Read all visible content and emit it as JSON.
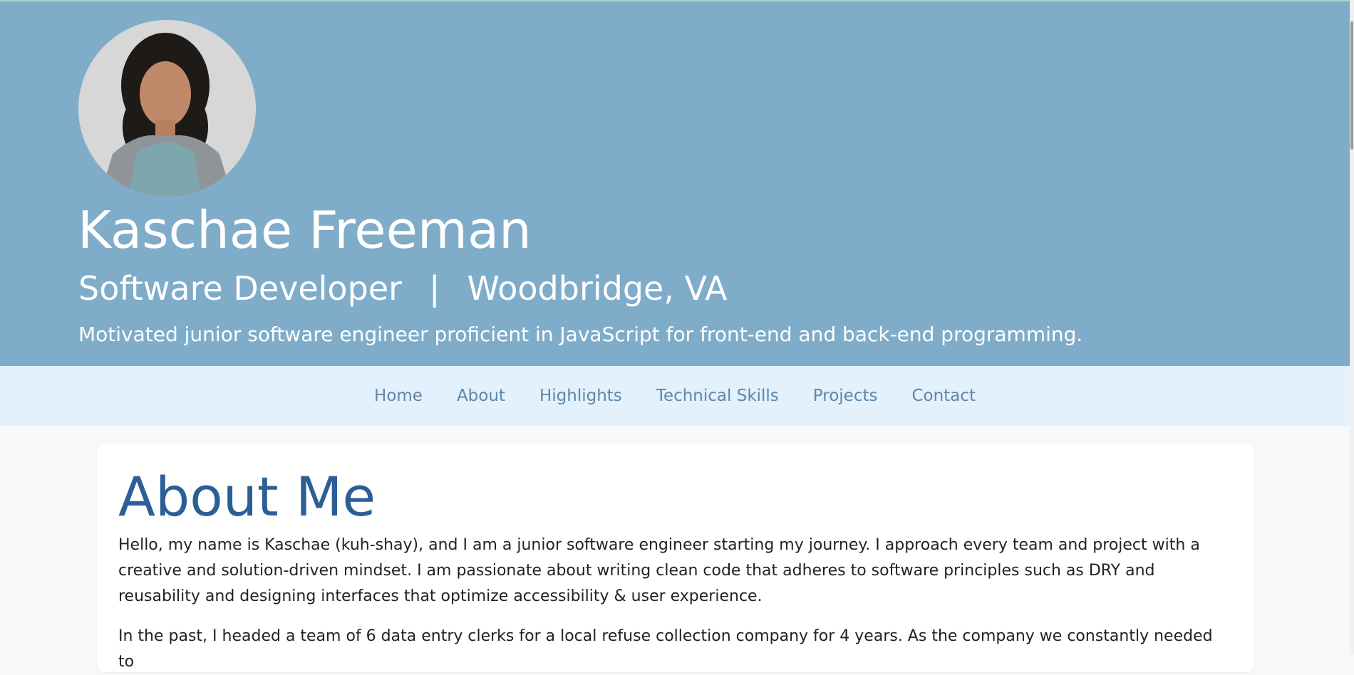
{
  "hero": {
    "name": "Kaschae Freeman",
    "role": "Software Developer",
    "separator": "|",
    "location": "Woodbridge, VA",
    "tagline": "Motivated junior software engineer proficient in JavaScript for front-end and back-end programming."
  },
  "nav": {
    "items": [
      {
        "label": "Home"
      },
      {
        "label": "About"
      },
      {
        "label": "Highlights"
      },
      {
        "label": "Technical Skills"
      },
      {
        "label": "Projects"
      },
      {
        "label": "Contact"
      }
    ]
  },
  "about": {
    "title": "About Me",
    "paragraphs": [
      "Hello, my name is Kaschae (kuh-shay), and I am a junior software engineer starting my journey. I approach every team and project with a creative and solution-driven mindset. I am passionate about writing clean code that adheres to software principles such as DRY and reusability and designing interfaces that optimize accessibility & user experience.",
      "In the past, I headed a team of 6 data entry clerks for a local refuse collection company for 4 years. As the company we constantly needed to"
    ]
  },
  "colors": {
    "hero_background": "#7facc8",
    "nav_background": "#e3f1fc",
    "nav_link": "#5f87a8",
    "heading": "#2c5f97",
    "page_background": "#f6f8fa"
  }
}
